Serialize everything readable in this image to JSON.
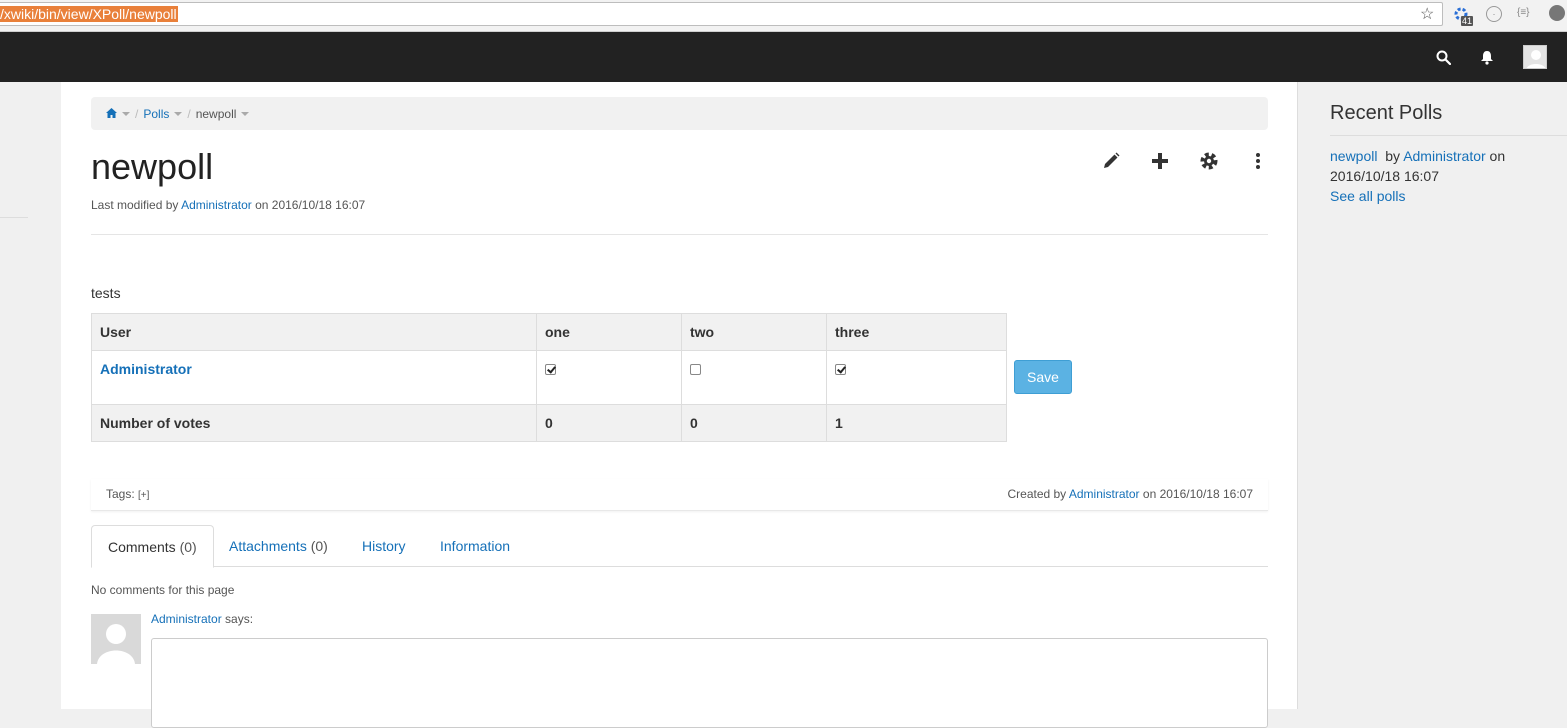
{
  "browser": {
    "url": "/xwiki/bin/view/XPoll/newpoll",
    "extension_badge": "41",
    "extension_label": "{≡}"
  },
  "breadcrumb": {
    "items": [
      "Polls",
      "newpoll"
    ]
  },
  "page": {
    "title": "newpoll",
    "lastmod_prefix": "Last modified by",
    "lastmod_author": "Administrator",
    "lastmod_suffix": "on 2016/10/18 16:07"
  },
  "poll": {
    "intro": "tests",
    "headers": [
      "User",
      "one",
      "two",
      "three"
    ],
    "vote_row": {
      "user": "Administrator",
      "checks": [
        true,
        false,
        true
      ]
    },
    "count_row": {
      "label": "Number of votes",
      "values": [
        "0",
        "0",
        "1"
      ]
    },
    "save_label": "Save"
  },
  "docfooter": {
    "tags_label": "Tags:",
    "tags_add": "[+]",
    "created_prefix": "Created by",
    "created_author": "Administrator",
    "created_suffix": "on 2016/10/18 16:07"
  },
  "tabs": [
    {
      "label": "Comments",
      "count": "(0)"
    },
    {
      "label": "Attachments",
      "count": "(0)"
    },
    {
      "label": "History",
      "count": ""
    },
    {
      "label": "Information",
      "count": ""
    }
  ],
  "comments": {
    "empty_text": "No comments for this page",
    "author": "Administrator",
    "says": "says:"
  },
  "sidebar": {
    "title": "Recent Polls",
    "poll_link": "newpoll",
    "by": "by",
    "author": "Administrator",
    "on": "on",
    "date": "2016/10/18 16:07",
    "see_all": "See all polls"
  },
  "colors": {
    "navbar": "#222222",
    "link": "#1570b8",
    "save_button": "#5bb2e3",
    "url_highlight": "#e9803a"
  },
  "icons": [
    "star-icon",
    "search-icon",
    "bell-icon",
    "user-avatar-icon",
    "home-icon",
    "pencil-icon",
    "plus-icon",
    "gear-icon",
    "vertical-dots-icon"
  ]
}
